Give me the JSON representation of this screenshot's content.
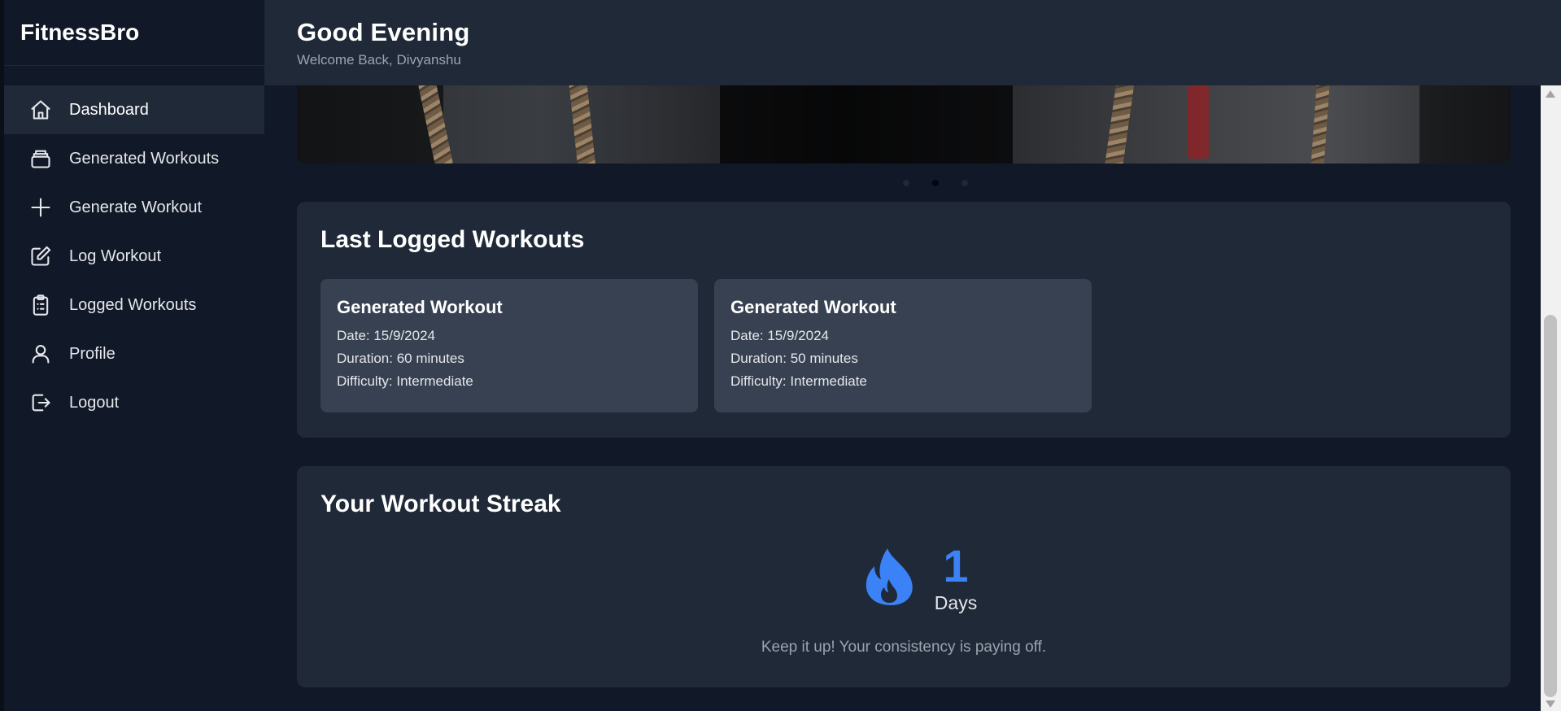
{
  "sidebar": {
    "brand": "FitnessBro",
    "items": [
      {
        "label": "Dashboard",
        "icon": "home-icon",
        "active": true
      },
      {
        "label": "Generated Workouts",
        "icon": "stack-icon"
      },
      {
        "label": "Generate Workout",
        "icon": "plus-icon"
      },
      {
        "label": "Log Workout",
        "icon": "edit-icon"
      },
      {
        "label": "Logged Workouts",
        "icon": "clipboard-list-icon"
      },
      {
        "label": "Profile",
        "icon": "user-icon"
      },
      {
        "label": "Logout",
        "icon": "logout-icon"
      }
    ]
  },
  "header": {
    "greeting": "Good Evening",
    "subtitle": "Welcome Back, Divyanshu"
  },
  "carousel": {
    "slide_count": 3,
    "active_index": 1
  },
  "last_logged": {
    "title": "Last Logged Workouts",
    "workouts": [
      {
        "title": "Generated Workout",
        "date": "Date: 15/9/2024",
        "duration": "Duration: 60 minutes",
        "difficulty": "Difficulty: Intermediate"
      },
      {
        "title": "Generated Workout",
        "date": "Date: 15/9/2024",
        "duration": "Duration: 50 minutes",
        "difficulty": "Difficulty: Intermediate"
      }
    ]
  },
  "streak": {
    "title": "Your Workout Streak",
    "count": "1",
    "unit": "Days",
    "message": "Keep it up! Your consistency is paying off.",
    "accent_color": "#3b82f6",
    "icon": "fire-icon"
  },
  "colors": {
    "background": "#111827",
    "panel": "#1f2937",
    "card": "#374151",
    "accent": "#3b82f6"
  }
}
